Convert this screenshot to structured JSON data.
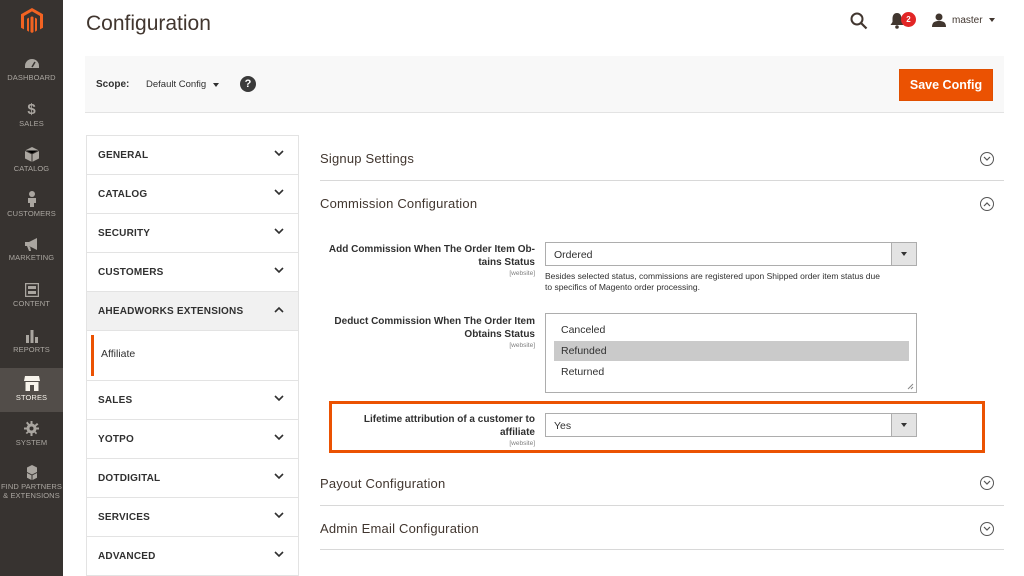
{
  "nav": {
    "items": [
      {
        "label": "DASHBOARD"
      },
      {
        "label": "SALES"
      },
      {
        "label": "CATALOG"
      },
      {
        "label": "CUSTOMERS"
      },
      {
        "label": "MARKETING"
      },
      {
        "label": "CONTENT"
      },
      {
        "label": "REPORTS"
      },
      {
        "label": "STORES"
      },
      {
        "label": "SYSTEM"
      },
      {
        "label": "FIND PARTNERS",
        "label2": "& EXTENSIONS"
      }
    ]
  },
  "header": {
    "title": "Configuration",
    "notifications_count": "2",
    "user": "master"
  },
  "scope": {
    "label": "Scope:",
    "value": "Default Config",
    "help": "?"
  },
  "toolbar": {
    "save_label": "Save Config"
  },
  "tabs": {
    "general": "GENERAL",
    "catalog": "CATALOG",
    "security": "SECURITY",
    "customers": "CUSTOMERS",
    "aheadworks": "AHEADWORKS EXTENSIONS",
    "affiliate": "Affiliate",
    "sales": "SALES",
    "yotpo": "YOTPO",
    "dotdigital": "DOTDIGITAL",
    "services": "SERVICES",
    "advanced": "ADVANCED"
  },
  "sections": {
    "signup": "Signup Settings",
    "commission": "Commission Configuration",
    "payout": "Payout Configuration",
    "admin_email": "Admin Email Configuration"
  },
  "fields": {
    "add_commission": {
      "label1": "Add Commission When The Order Item Ob-",
      "label2": "tains Status",
      "scope": "[website]",
      "value": "Ordered",
      "note1": "Besides selected status, commissions are registered upon Shipped order item status due",
      "note2": "to specifics of Magento order processing."
    },
    "deduct_commission": {
      "label1": "Deduct Commission When The Order Item",
      "label2": "Obtains Status",
      "scope": "[website]",
      "options": [
        "Canceled",
        "Refunded",
        "Returned"
      ],
      "selected": "Refunded"
    },
    "lifetime": {
      "label1": "Lifetime attribution of a customer to",
      "label2": "affiliate",
      "scope": "[website]",
      "value": "Yes"
    }
  },
  "colors": {
    "accent": "#eb5202",
    "nav_bg": "#373330"
  }
}
